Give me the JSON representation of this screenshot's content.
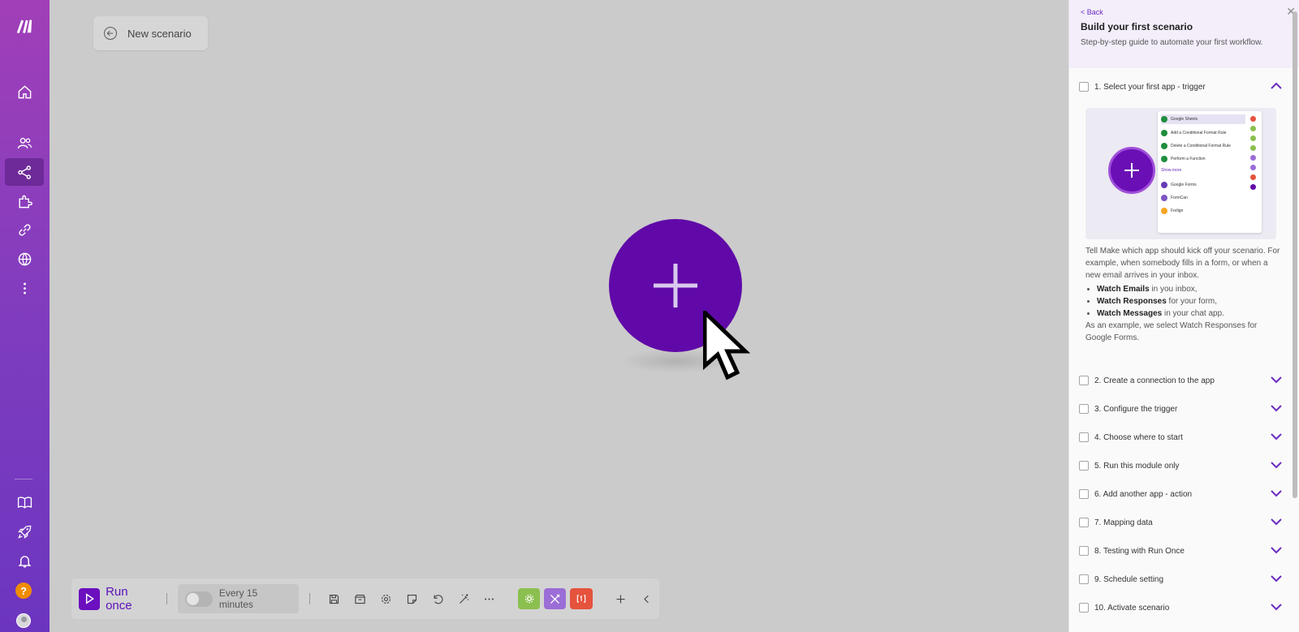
{
  "sidebar": {
    "items": [
      {
        "name": "make-logo-icon"
      },
      {
        "name": "home-icon"
      },
      {
        "name": "team-icon"
      },
      {
        "name": "scenarios-icon",
        "active": true
      },
      {
        "name": "apps-icon"
      },
      {
        "name": "connections-icon"
      },
      {
        "name": "webhooks-icon"
      },
      {
        "name": "more-icon"
      },
      {
        "name": "docs-icon"
      },
      {
        "name": "rocket-icon"
      },
      {
        "name": "bell-icon"
      },
      {
        "name": "help-icon",
        "label": "?"
      },
      {
        "name": "avatar"
      }
    ]
  },
  "canvas": {
    "scenario_name": "New scenario",
    "accent": "#6009a8"
  },
  "toolbar": {
    "run_label": "Run once",
    "schedule_label": "Every 15 minutes",
    "icons": [
      "save-icon",
      "blueprint-icon",
      "settings-icon",
      "notes-icon",
      "undo-icon",
      "magic-wand-icon",
      "more-icon"
    ],
    "modules": [
      {
        "name": "module-green",
        "color": "#8bbf4f",
        "glyph": "⚙"
      },
      {
        "name": "module-purple",
        "color": "#9b6dd6",
        "glyph": "✕"
      },
      {
        "name": "module-red",
        "color": "#e5533d",
        "glyph": "[]"
      }
    ]
  },
  "guide": {
    "back": "< Back",
    "title": "Build your first scenario",
    "subtitle": "Step-by-step guide to automate your first workflow.",
    "steps": [
      "1. Select your first app - trigger",
      "2. Create a connection to the app",
      "3. Configure the trigger",
      "4. Choose where to start",
      "5. Run this module only",
      "6. Add another app - action",
      "7. Mapping data",
      "8. Testing with Run Once",
      "9. Schedule setting",
      "10. Activate scenario"
    ],
    "description": "Tell Make which app should kick off your scenario. For example, when somebody fills in a form, or when a new email arrives in your inbox.",
    "bullets": [
      {
        "bold": "Watch Emails",
        "text": " in you inbox,"
      },
      {
        "bold": "Watch Responses",
        "text": " for your form,"
      },
      {
        "bold": "Watch Messages",
        "text": " in your chat app."
      }
    ],
    "example": "As an example, we select Watch Responses for Google Forms.",
    "image_list": [
      "Google Sheets",
      "Add a Conditional Format Rule",
      "Delete a Conditional Format Rule",
      "Perform a Function",
      "Show more",
      "Google Forms",
      "FormCan",
      "Forlign"
    ]
  }
}
